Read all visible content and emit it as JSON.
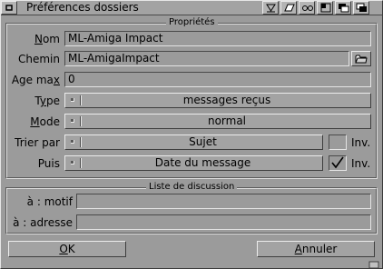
{
  "window": {
    "title": "Préférences dossiers"
  },
  "titlebar": {
    "buttons": [
      {
        "name": "close-icon"
      },
      {
        "name": "iconify-icon"
      },
      {
        "name": "snapshot-icon"
      },
      {
        "name": "zoom-icon"
      },
      {
        "name": "depth-icon"
      }
    ]
  },
  "properties": {
    "title": "Propriétés",
    "nom": {
      "label_u": "N",
      "label_rest": "om",
      "value": "ML-Amiga Impact"
    },
    "chemin": {
      "label": "Chemin",
      "value": "ML-AmigaImpact"
    },
    "age_max": {
      "label_pre": "Age ma",
      "label_u": "x",
      "value": "0"
    },
    "type": {
      "label_pre": "T",
      "label_u": "y",
      "label_rest": "pe",
      "value": "messages reçus"
    },
    "mode": {
      "label_u": "M",
      "label_rest": "ode",
      "value": "normal"
    },
    "trier_par": {
      "label": "Trier par",
      "value": "Sujet",
      "inv_label": "Inv.",
      "inv_checked": false
    },
    "puis": {
      "label": "Puis",
      "value": "Date du message",
      "inv_label": "Inv.",
      "inv_checked": true
    }
  },
  "discussion": {
    "title": "Liste de discussion",
    "motif": {
      "label": "à : motif",
      "value": ""
    },
    "adresse": {
      "label": "à : adresse",
      "value": ""
    }
  },
  "actions": {
    "ok_u": "O",
    "ok_rest": "K",
    "annuler_u": "A",
    "annuler_rest": "nnuler"
  },
  "colors": {
    "background": "#9b9b9b",
    "shine": "#ececec",
    "shadow": "#3e3e3e"
  }
}
